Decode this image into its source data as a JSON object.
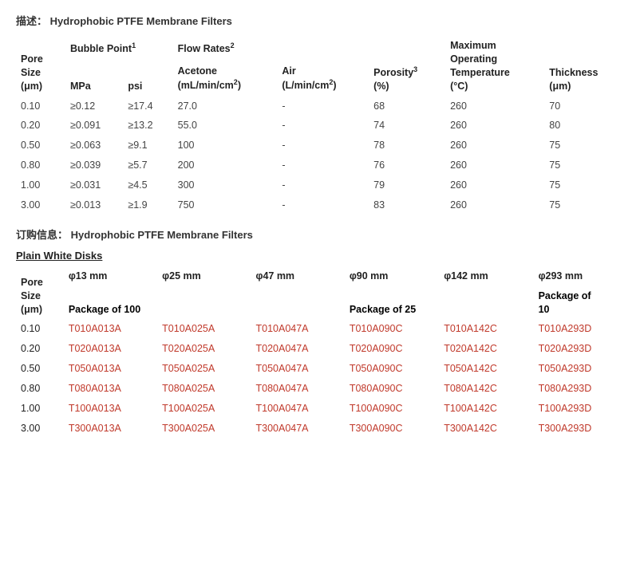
{
  "description_label": "描述：",
  "description_value": "Hydrophobic PTFE Membrane Filters",
  "specs_table": {
    "headers": {
      "pore_size": "Pore Size (μm)",
      "bubble_point": "Bubble Point",
      "bubble_sup": "1",
      "mpa": "MPa",
      "psi": "psi",
      "flow_rates": "Flow Rates",
      "flow_sup": "2",
      "acetone": "Acetone (mL/min/cm²)",
      "air": "Air (L/min/cm²)",
      "porosity": "Porosity",
      "porosity_sup": "3",
      "porosity_unit": "(%)",
      "max_temp": "Maximum Operating Temperature (°C)",
      "thickness": "Thickness (μm)"
    },
    "rows": [
      {
        "pore": "0.10",
        "mpa": "≥0.12",
        "psi": "≥17.4",
        "acetone": "27.0",
        "air": "-",
        "porosity": "68",
        "max_temp": "260",
        "thickness": "70"
      },
      {
        "pore": "0.20",
        "mpa": "≥0.091",
        "psi": "≥13.2",
        "acetone": "55.0",
        "air": "-",
        "porosity": "74",
        "max_temp": "260",
        "thickness": "80"
      },
      {
        "pore": "0.50",
        "mpa": "≥0.063",
        "psi": "≥9.1",
        "acetone": "100",
        "air": "-",
        "porosity": "78",
        "max_temp": "260",
        "thickness": "75"
      },
      {
        "pore": "0.80",
        "mpa": "≥0.039",
        "psi": "≥5.7",
        "acetone": "200",
        "air": "-",
        "porosity": "76",
        "max_temp": "260",
        "thickness": "75"
      },
      {
        "pore": "1.00",
        "mpa": "≥0.031",
        "psi": "≥4.5",
        "acetone": "300",
        "air": "-",
        "porosity": "79",
        "max_temp": "260",
        "thickness": "75"
      },
      {
        "pore": "3.00",
        "mpa": "≥0.013",
        "psi": "≥1.9",
        "acetone": "750",
        "air": "-",
        "porosity": "83",
        "max_temp": "260",
        "thickness": "75"
      }
    ]
  },
  "order_label": "订购信息：",
  "order_value": "Hydrophobic PTFE Membrane Filters",
  "plain_white_title": "Plain White Disks",
  "order_table": {
    "headers": {
      "pore_size": "Pore Size (μm)",
      "phi13": "φ13 mm",
      "phi25": "φ25 mm",
      "phi47": "φ47 mm",
      "phi90": "φ90 mm",
      "phi142": "φ142 mm",
      "phi293": "φ293 mm",
      "pkg_100": "Package of 100",
      "pkg_25": "Package of 25",
      "pkg_10": "Package of 10"
    },
    "rows": [
      {
        "pore": "0.10",
        "p13": "T010A013A",
        "p25": "T010A025A",
        "p47": "T010A047A",
        "p90": "T010A090C",
        "p142": "T010A142C",
        "p293": "T010A293D"
      },
      {
        "pore": "0.20",
        "p13": "T020A013A",
        "p25": "T020A025A",
        "p47": "T020A047A",
        "p90": "T020A090C",
        "p142": "T020A142C",
        "p293": "T020A293D"
      },
      {
        "pore": "0.50",
        "p13": "T050A013A",
        "p25": "T050A025A",
        "p47": "T050A047A",
        "p90": "T050A090C",
        "p142": "T050A142C",
        "p293": "T050A293D"
      },
      {
        "pore": "0.80",
        "p13": "T080A013A",
        "p25": "T080A025A",
        "p47": "T080A047A",
        "p90": "T080A090C",
        "p142": "T080A142C",
        "p293": "T080A293D"
      },
      {
        "pore": "1.00",
        "p13": "T100A013A",
        "p25": "T100A025A",
        "p47": "T100A047A",
        "p90": "T100A090C",
        "p142": "T100A142C",
        "p293": "T100A293D"
      },
      {
        "pore": "3.00",
        "p13": "T300A013A",
        "p25": "T300A025A",
        "p47": "T300A047A",
        "p90": "T300A090C",
        "p142": "T300A142C",
        "p293": "T300A293D"
      }
    ]
  }
}
